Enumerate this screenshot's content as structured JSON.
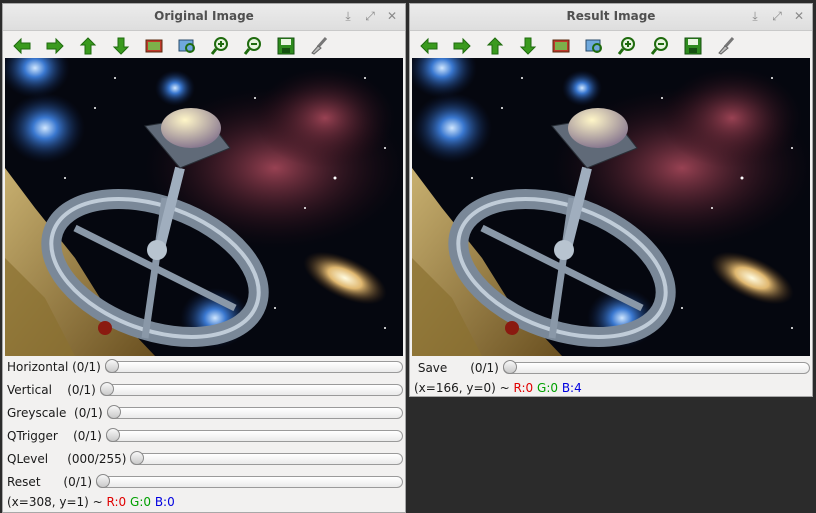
{
  "windows": {
    "original": {
      "title": "Original Image",
      "trackbars": [
        {
          "name": "Horizontal",
          "value": "(0/1)"
        },
        {
          "name": "Vertical",
          "value": "(0/1)"
        },
        {
          "name": "Greyscale",
          "value": "(0/1)"
        },
        {
          "name": "QTrigger",
          "value": "(0/1)"
        },
        {
          "name": "QLevel",
          "value": "(000/255)"
        },
        {
          "name": "Reset",
          "value": "(0/1)"
        }
      ],
      "status": {
        "coords": "(x=308, y=1) ~ ",
        "r": "R:0",
        "g": "G:0",
        "b": "B:0"
      }
    },
    "result": {
      "title": "Result Image",
      "trackbars": [
        {
          "name": "Save",
          "value": "(0/1)"
        }
      ],
      "status": {
        "coords": "(x=166, y=0) ~ ",
        "r": "R:0",
        "g": "G:0",
        "b": "B:4"
      }
    }
  },
  "toolbar_icons": [
    "arrow-left-icon",
    "arrow-right-icon",
    "arrow-up-icon",
    "arrow-down-icon",
    "image-icon",
    "zoom-fit-icon",
    "zoom-in-icon",
    "zoom-out-icon",
    "save-icon",
    "properties-brush-icon"
  ],
  "titlebar_icons": [
    "pin-icon",
    "maximize-icon",
    "close-icon"
  ],
  "colors": {
    "arrow": "#3a9a1e",
    "save": "#2e8b1e",
    "status_r": "#e00000",
    "status_g": "#00a000",
    "status_b": "#0000e0"
  }
}
